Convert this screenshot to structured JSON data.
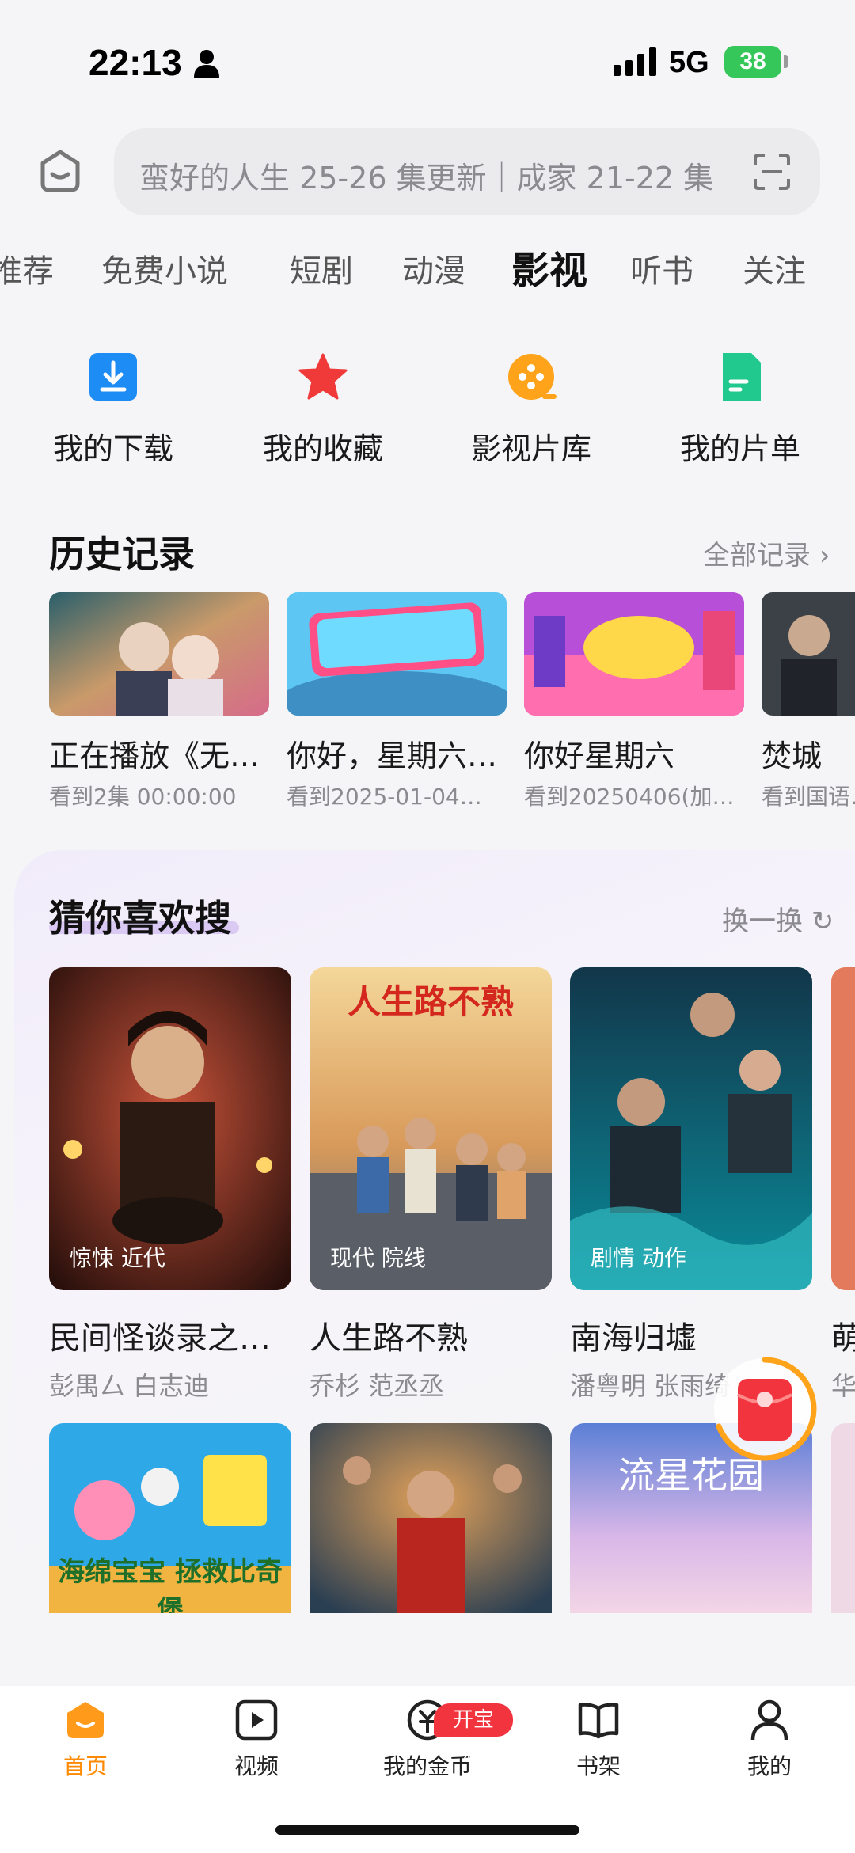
{
  "status": {
    "time": "22:13",
    "network": "5G",
    "battery": "38"
  },
  "search": {
    "placeholder": "蛮好的人生 25-26 集更新｜成家 21-22 集"
  },
  "tabs": [
    {
      "label": "推荐"
    },
    {
      "label": "免费小说"
    },
    {
      "label": "短剧"
    },
    {
      "label": "动漫"
    },
    {
      "label": "影视",
      "active": true
    },
    {
      "label": "听书"
    },
    {
      "label": "关注"
    }
  ],
  "quick_actions": [
    {
      "label": "我的下载",
      "icon": "download-icon",
      "color": "#1e8cf5"
    },
    {
      "label": "我的收藏",
      "icon": "star-icon",
      "color": "#f03a3a"
    },
    {
      "label": "影视片库",
      "icon": "film-reel-icon",
      "color": "#ffa31a"
    },
    {
      "label": "我的片单",
      "icon": "list-icon",
      "color": "#22c98f"
    }
  ],
  "history": {
    "title": "历史记录",
    "link": "全部记录",
    "items": [
      {
        "title": "正在播放《无…",
        "sub": "看到2集 00:00:00"
      },
      {
        "title": "你好，星期六…",
        "sub": "看到2025-01-04…"
      },
      {
        "title": "你好星期六",
        "sub": "看到20250406(加…"
      },
      {
        "title": "焚城",
        "sub": "看到国语…"
      }
    ]
  },
  "guess": {
    "title": "猜你喜欢搜",
    "link": "换一换",
    "items": [
      {
        "title": "民间怪谈录之…",
        "sub": "彭禺厶 白志迪",
        "tag": "惊悚 近代"
      },
      {
        "title": "人生路不熟",
        "sub": "乔杉 范丞丞",
        "tag": "现代 院线",
        "poster_text": "人生路不熟"
      },
      {
        "title": "南海归墟",
        "sub": "潘粤明 张雨绮",
        "tag": "剧情 动作"
      },
      {
        "title": "萌",
        "sub": "华"
      }
    ],
    "row2_poster_text": [
      "海绵宝宝 拯救比奇堡",
      "",
      "流星花园"
    ]
  },
  "bottom_nav": [
    {
      "label": "首页",
      "icon": "home-icon",
      "active": true
    },
    {
      "label": "视频",
      "icon": "video-icon"
    },
    {
      "label": "我的金币",
      "icon": "coin-icon",
      "badge": "开宝箱"
    },
    {
      "label": "书架",
      "icon": "bookshelf-icon"
    },
    {
      "label": "我的",
      "icon": "profile-icon"
    }
  ],
  "colors": {
    "accent": "#ff8a00",
    "badge": "#f2343f",
    "guess_underline": "#d9c9f3"
  }
}
